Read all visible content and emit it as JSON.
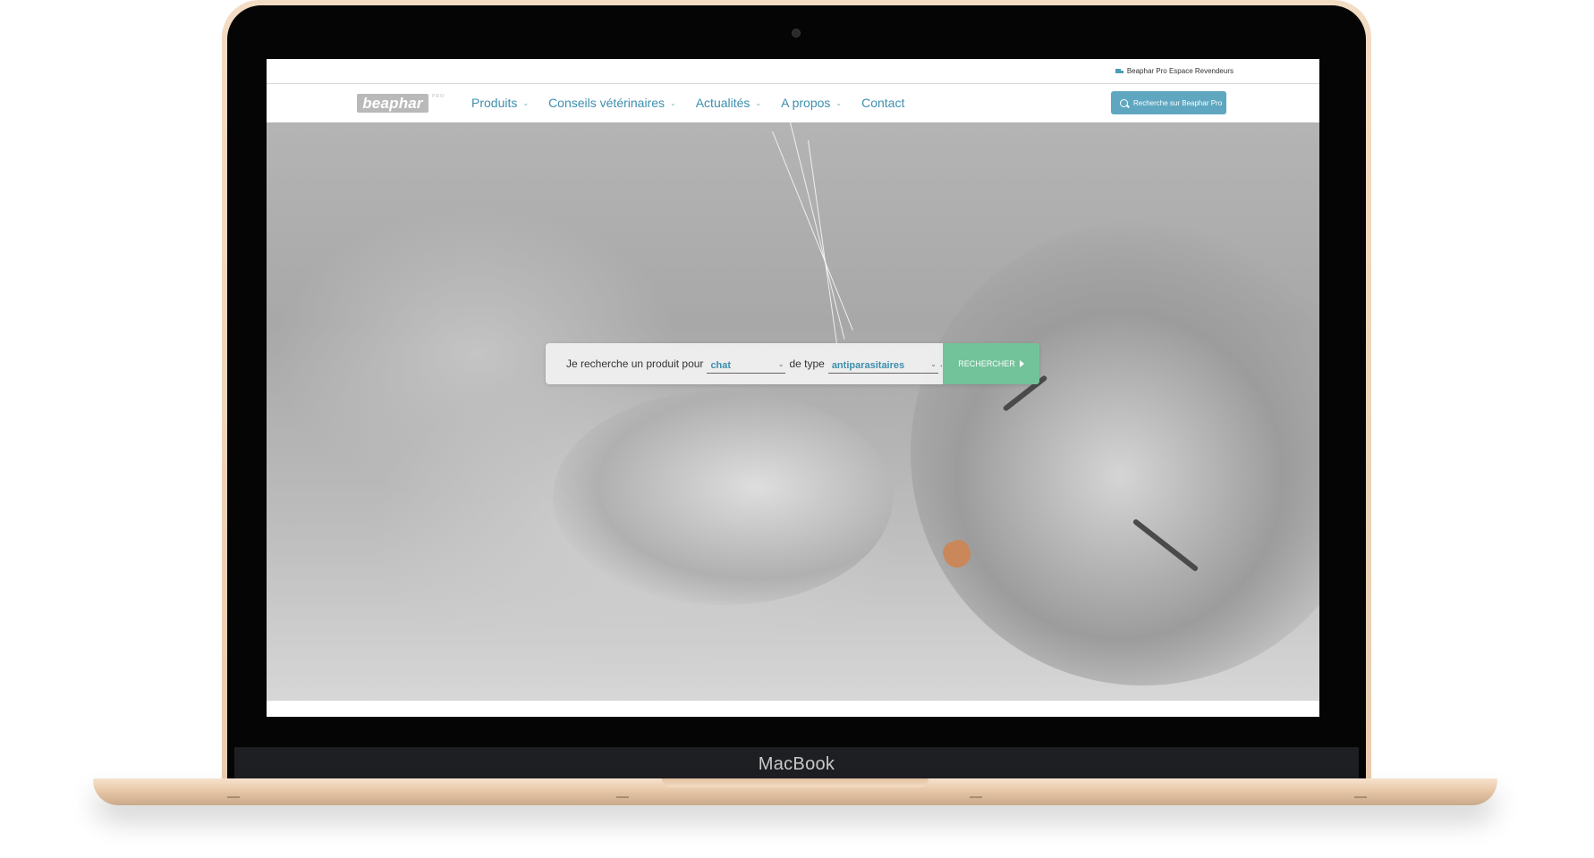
{
  "device": {
    "brand": "MacBook"
  },
  "topbar": {
    "pro_link": "Beaphar Pro Espace Revendeurs"
  },
  "header": {
    "logo_text": "beaphar",
    "logo_sup": "PRO",
    "nav": [
      {
        "label": "Produits",
        "has_dropdown": true
      },
      {
        "label": "Conseils vétérinaires",
        "has_dropdown": true
      },
      {
        "label": "Actualités",
        "has_dropdown": true
      },
      {
        "label": "A propos",
        "has_dropdown": true
      },
      {
        "label": "Contact",
        "has_dropdown": false
      }
    ],
    "search_button": "Recherche sur Beaphar Pro"
  },
  "hero": {
    "finder": {
      "prefix": "Je recherche un produit pour",
      "animal_value": "chat",
      "middle": "de type",
      "type_value": "antiparasitaires",
      "suffix": ".",
      "button": "RECHERCHER"
    }
  },
  "colors": {
    "accent": "#3d8fae",
    "search_button": "#5fa7c0",
    "cta_green": "#73c39a",
    "laptop_gold": "#e9ccaf"
  }
}
